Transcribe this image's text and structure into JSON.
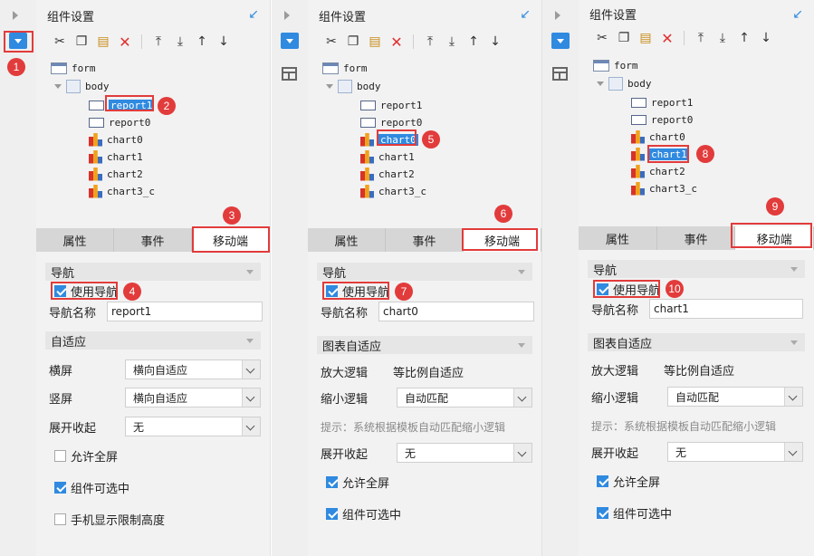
{
  "accent": "#2f8ae0",
  "callout_color": "#e23b3b",
  "header": {
    "title": "组件设置",
    "pin_icon": "pin-icon"
  },
  "toolbar": [
    "cut-icon",
    "copy-icon",
    "paste-icon",
    "delete-icon",
    "move-top-icon",
    "move-bottom-icon",
    "move-up-icon",
    "move-down-icon"
  ],
  "tree": {
    "form": "form",
    "body": "body",
    "nodes": [
      "report1",
      "report0",
      "chart0",
      "chart1",
      "chart2",
      "chart3_c"
    ]
  },
  "tabs": [
    "属性",
    "事件",
    "移动端"
  ],
  "panel1": {
    "nav_section": "导航",
    "use_nav": "使用导航",
    "nav_name_label": "导航名称",
    "nav_name_value": "report1",
    "adapt_section": "自适应",
    "landscape_label": "横屏",
    "landscape_value": "横向自适应",
    "portrait_label": "竖屏",
    "portrait_value": "横向自适应",
    "expand_label": "展开收起",
    "expand_value": "无",
    "allow_fullscreen": "允许全屏",
    "selectable": "组件可选中",
    "limit_height": "手机显示限制高度",
    "callouts": [
      "1",
      "2",
      "3",
      "4"
    ]
  },
  "panel2": {
    "nav_section": "导航",
    "use_nav": "使用导航",
    "nav_name_label": "导航名称",
    "nav_name_value": "chart0",
    "adapt_section": "图表自适应",
    "zoom_in_label": "放大逻辑",
    "zoom_in_value": "等比例自适应",
    "zoom_out_label": "缩小逻辑",
    "zoom_out_value": "自动匹配",
    "hint": "提示：系统根据模板自动匹配缩小逻辑",
    "expand_label": "展开收起",
    "expand_value": "无",
    "allow_fullscreen": "允许全屏",
    "selectable": "组件可选中",
    "callouts": [
      "5",
      "6",
      "7"
    ]
  },
  "panel3": {
    "nav_section": "导航",
    "use_nav": "使用导航",
    "nav_name_label": "导航名称",
    "nav_name_value": "chart1",
    "adapt_section": "图表自适应",
    "zoom_in_label": "放大逻辑",
    "zoom_in_value": "等比例自适应",
    "zoom_out_label": "缩小逻辑",
    "zoom_out_value": "自动匹配",
    "hint": "提示：系统根据模板自动匹配缩小逻辑",
    "expand_label": "展开收起",
    "expand_value": "无",
    "allow_fullscreen": "允许全屏",
    "selectable": "组件可选中",
    "callouts": [
      "8",
      "9",
      "10"
    ]
  }
}
